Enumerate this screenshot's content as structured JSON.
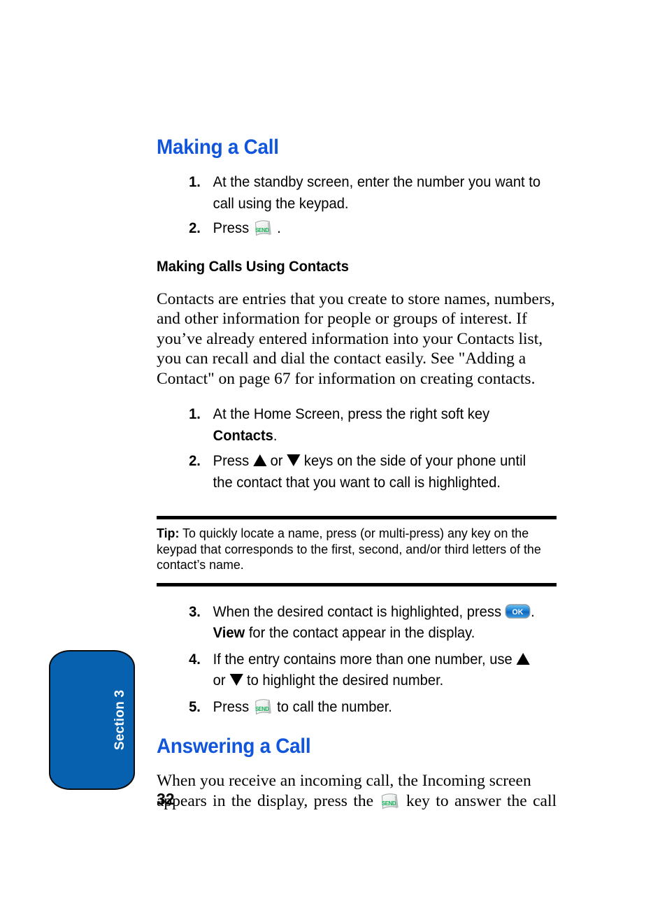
{
  "page": {
    "number": "32",
    "side_tab_label": "Section 3",
    "accent_heading_color": "#1055DC",
    "side_tab_color": "#0761AF"
  },
  "sections": {
    "making_a_call": {
      "heading": "Making a Call",
      "steps": [
        {
          "number": "1.",
          "text": "At the standby screen, enter the number you want to call using the keypad."
        },
        {
          "number": "2.",
          "text_before": "Press",
          "icon": "send-key-icon",
          "text_after": "."
        }
      ]
    },
    "making_calls_using_contacts": {
      "heading": "Making Calls Using Contacts",
      "paragraph": "Contacts are entries that you create to store names, numbers, and other information for people or groups of interest. If you’ve already entered information into your Contacts list, you can recall and dial the contact easily. See \"Adding a Contact\" on page 67 for information on creating contacts.",
      "steps": [
        {
          "number": "1.",
          "text_before": "At the Home Screen, press the right soft key ",
          "bold": "Contacts",
          "text_after": "."
        },
        {
          "number": "2.",
          "text_before": "Press ",
          "icon_up": "up-arrow-key-icon",
          "text_middle": " or ",
          "icon_down": "down-arrow-key-icon",
          "text_after": " keys on the side of your phone until the contact that you want to call is highlighted."
        }
      ],
      "tip": {
        "label": "Tip:",
        "text": " To quickly locate a name, press (or multi-press) any key on the keypad that corresponds to the first, second, and/or third letters of the contact’s name."
      },
      "steps_continued": [
        {
          "number": "3.",
          "text_before": "When the desired contact is highlighted, press ",
          "icon": "ok-key-icon",
          "text_after": ". ",
          "bold": "View",
          "text_end": " for the contact appear in the display."
        },
        {
          "number": "4.",
          "text_before": "If the entry contains more than one number, use ",
          "icon_up": "up-arrow-key-icon",
          "text_middle": " or ",
          "icon_down": "down-arrow-key-icon",
          "text_after": " to highlight the desired number."
        },
        {
          "number": "5.",
          "text_before": "Press ",
          "icon": "send-key-icon",
          "text_after": " to call the number."
        }
      ]
    },
    "answering_a_call": {
      "heading": "Answering a Call",
      "paragraph_line1": "When you receive an incoming call, the Incoming screen",
      "paragraph_line2_before": "appears in the display, press the",
      "paragraph_line2_icon": "send-key-icon",
      "paragraph_line2_after": "key to answer the call"
    }
  },
  "icons": {
    "send_key_label": "SEND",
    "ok_key_label": "OK"
  }
}
